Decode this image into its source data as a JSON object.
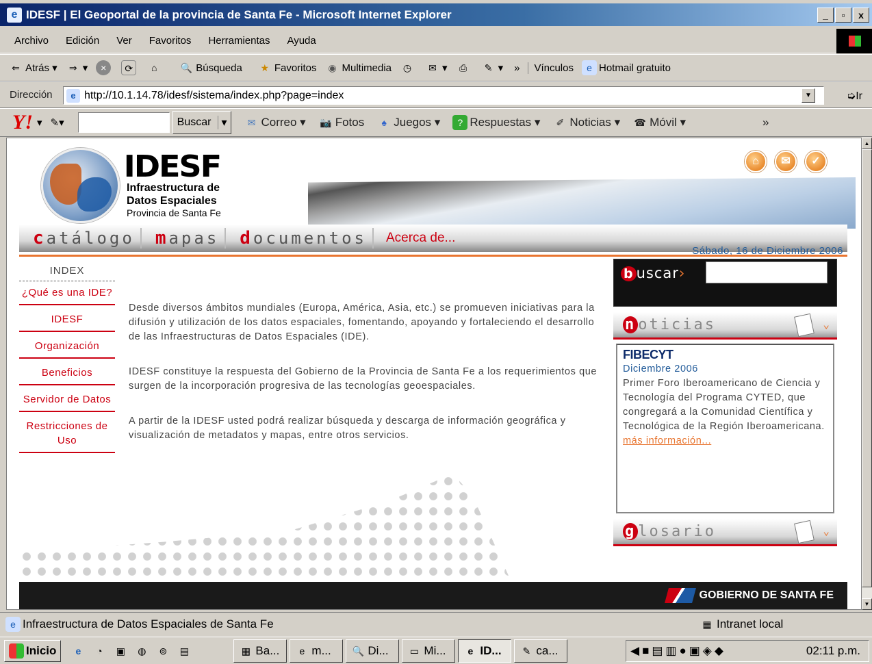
{
  "window": {
    "title": "IDESF | El Geoportal de la provincia de Santa Fe - Microsoft Internet Explorer",
    "min": "_",
    "max": "▫",
    "close": "x"
  },
  "menubar": [
    "Archivo",
    "Edición",
    "Ver",
    "Favoritos",
    "Herramientas",
    "Ayuda"
  ],
  "stdbar": {
    "back": "Atrás",
    "search": "Búsqueda",
    "favorites": "Favoritos",
    "multimedia": "Multimedia",
    "links": "Vínculos",
    "hotmail": "Hotmail gratuito",
    "chevron": "»"
  },
  "address": {
    "label": "Dirección",
    "url": "http://10.1.14.78/idesf/sistema/index.php?page=index",
    "go": "Ir"
  },
  "yahoo": {
    "logo": "Y!",
    "search_btn": "Buscar",
    "items": [
      "Correo",
      "Fotos",
      "Juegos",
      "Respuestas",
      "Noticias",
      "Móvil"
    ],
    "chevron": "»"
  },
  "page": {
    "brand": "IDESF",
    "sub1": "Infraestructura de",
    "sub2": "Datos Espaciales",
    "sub3": "Provincia de Santa Fe",
    "nav": [
      {
        "initial": "c",
        "rest": "atálogo"
      },
      {
        "initial": "m",
        "rest": "apas"
      },
      {
        "initial": "d",
        "rest": "ocumentos"
      }
    ],
    "nav_about": "Acerca de...",
    "date": "Sábado, 16 de Diciembre 2006",
    "menu_head": "INDEX",
    "menu": [
      "¿Qué es una IDE?",
      "IDESF",
      "Organización",
      "Beneficios",
      "Servidor de Datos",
      "Restricciones de Uso"
    ],
    "paragraphs": [
      "Desde diversos ámbitos mundiales (Europa, América, Asia, etc.) se promueven iniciativas para la difusión y utilización de los datos espaciales, fomentando, apoyando y fortaleciendo el desarrollo de las Infraestructuras de Datos Espaciales (IDE).",
      "IDESF constituye la respuesta del Gobierno de la Provincia de Santa Fe a los requerimientos que surgen de la incorporación progresiva de las tecnologías geoespaciales.",
      "A partir de la IDESF usted podrá realizar búsqueda y descarga de información geográfica y visualización de metadatos y mapas, entre otros servicios."
    ],
    "search_initial": "b",
    "search_rest": "uscar",
    "search_arrow": "›",
    "news_initial": "n",
    "news_rest": "oticias",
    "news": {
      "title": "FIBECYT",
      "date": "Diciembre 2006",
      "body": "Primer Foro Iberoamericano de Ciencia y Tecnología del Programa CYTED, que congregará a la Comunidad Científica y Tecnológica de la Región Iberoamericana.",
      "more": "más información..."
    },
    "gloss_initial": "g",
    "gloss_rest": "losario",
    "footer": "GOBIERNO DE SANTA FE"
  },
  "status": {
    "text": "Infraestructura de Datos Espaciales de Santa Fe",
    "zone": "Intranet local"
  },
  "taskbar": {
    "start": "Inicio",
    "tasks": [
      "Ba...",
      "m...",
      "Di...",
      "Mi...",
      "ID...",
      "ca..."
    ],
    "clock": "02:11 p.m."
  }
}
